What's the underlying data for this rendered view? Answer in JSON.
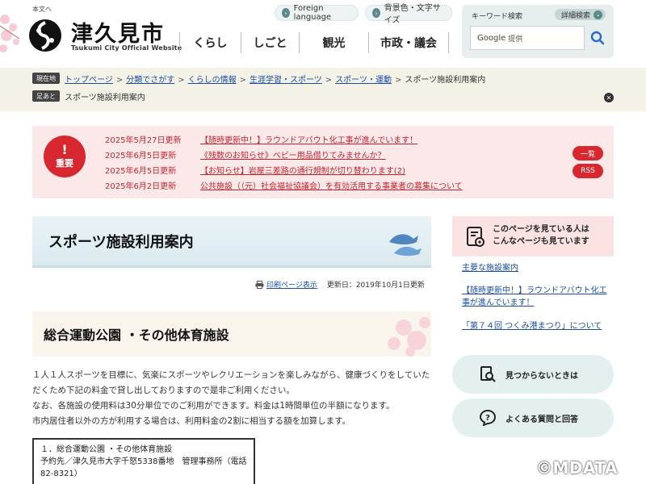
{
  "header": {
    "skip_link": "本文へ",
    "site_name": "津久見市",
    "site_name_en": "Tsukumi City Official Website",
    "lang_label": "Foreign language",
    "color_label": "背景色・文字サイズ",
    "nav": [
      "くらし",
      "しごと",
      "観光",
      "市政・議会"
    ],
    "search": {
      "label": "キーワード検索",
      "advanced_label": "詳細検索",
      "google_label": "Google",
      "provided_label": "提供"
    }
  },
  "breadcrumb": {
    "current_tag": "現在地",
    "items": [
      "トップページ",
      "分類でさがす",
      "くらしの情報",
      "生涯学習・スポーツ",
      "スポーツ・運動"
    ],
    "current": "スポーツ施設利用案内",
    "footmark_tag": "足あと",
    "footmark_item": "スポーツ施設利用案内"
  },
  "emergency": {
    "badge_mark": "!",
    "badge_label": "重要",
    "items": [
      {
        "date": "2025年5月27日更新",
        "text": "【随時更新中！】ラウンドアバウト化工事が進んでいます！"
      },
      {
        "date": "2025年6月5日更新",
        "text": "《残数のお知らせ》ベビー用品借りてみませんか？"
      },
      {
        "date": "2025年6月5日更新",
        "text": "【お知らせ】岩屋三差路の通行規制が切り替わります(2)"
      },
      {
        "date": "2025年6月2日更新",
        "text": "公共施設（（元）社会福祉協議会）を有効活用する事業者の募集について"
      }
    ],
    "list_button": "一覧",
    "rss_button": "RSS"
  },
  "main": {
    "page_title": "スポーツ施設利用案内",
    "print_label": "印刷ページ表示",
    "updated_label": "更新日：2019年10月1日更新",
    "section_title": "総合運動公園 ・その他体育施設",
    "paragraphs": [
      "１人１人スポーツを目標に、気楽にスポーツやレクリエーションを楽しみながら、健康づくりをしていただくため下記の料金で貸し出しておりますので是非ご利用ください。",
      "なお、各施設の使用料は30分単位でのご利用ができます。料金は1時間単位の半額になります。",
      "市内居住者以外の方が利用する場合は、利用料金の2割に相当する額を加算します。"
    ],
    "info_box": {
      "line1": "１．総合運動公園 ・その他体育施設",
      "line2": "予約先／津久見市大字千怒5338番地　管理事務所（電話82-8321）"
    }
  },
  "sidebar": {
    "rec_title_1": "このページを見ている人は",
    "rec_title_2": "こんなページも見ています",
    "links": [
      "主要な施設案内",
      "【随時更新中！】ラウンドアバウト化工事が進んでいます！",
      "「第７４回 つくみ港まつり」について"
    ],
    "not_found": "見つからないときは",
    "faq": "よくある質問と回答"
  },
  "watermark": "©MDATA",
  "colors": {
    "accent_red": "#d7272f",
    "link_blue": "#1a4fa0",
    "teal": "#5a8a8a"
  }
}
